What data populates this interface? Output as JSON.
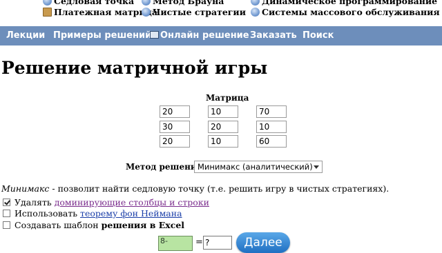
{
  "top_links": {
    "col1": [
      "Седловая точка",
      "Платежная матрица"
    ],
    "col2": [
      "Метод Брауна",
      "Чистые стратегии"
    ],
    "col3": [
      "Динамическое программирование",
      "Системы массового обслуживания"
    ]
  },
  "nav": [
    "Лекции",
    "Примеры решений",
    "Онлайн решение",
    "Заказать",
    "Поиск"
  ],
  "page_title": "Решение матричной игры",
  "matrix_label": "Матрица",
  "matrix": [
    [
      "20",
      "10",
      "70"
    ],
    [
      "30",
      "20",
      "10"
    ],
    [
      "20",
      "10",
      "60"
    ]
  ],
  "method": {
    "label": "Метод решения",
    "selected": "Минимакс (аналитический)"
  },
  "description": {
    "term": "Минимакс",
    "text": " - позволит найти седловую точку (т.е. решить игру в чистых стратегиях)."
  },
  "options": [
    {
      "prefix": "Удалять ",
      "link": "доминирующие столбцы и строки",
      "checked": true
    },
    {
      "prefix": "Использовать ",
      "link": "теорему фон Неймана",
      "checked": false
    },
    {
      "prefix": "Создавать шаблон ",
      "bold": "решения в Excel",
      "checked": false
    }
  ],
  "captcha": {
    "expression": "8-",
    "equals": "=",
    "answer": "?"
  },
  "next_button": "Далее"
}
